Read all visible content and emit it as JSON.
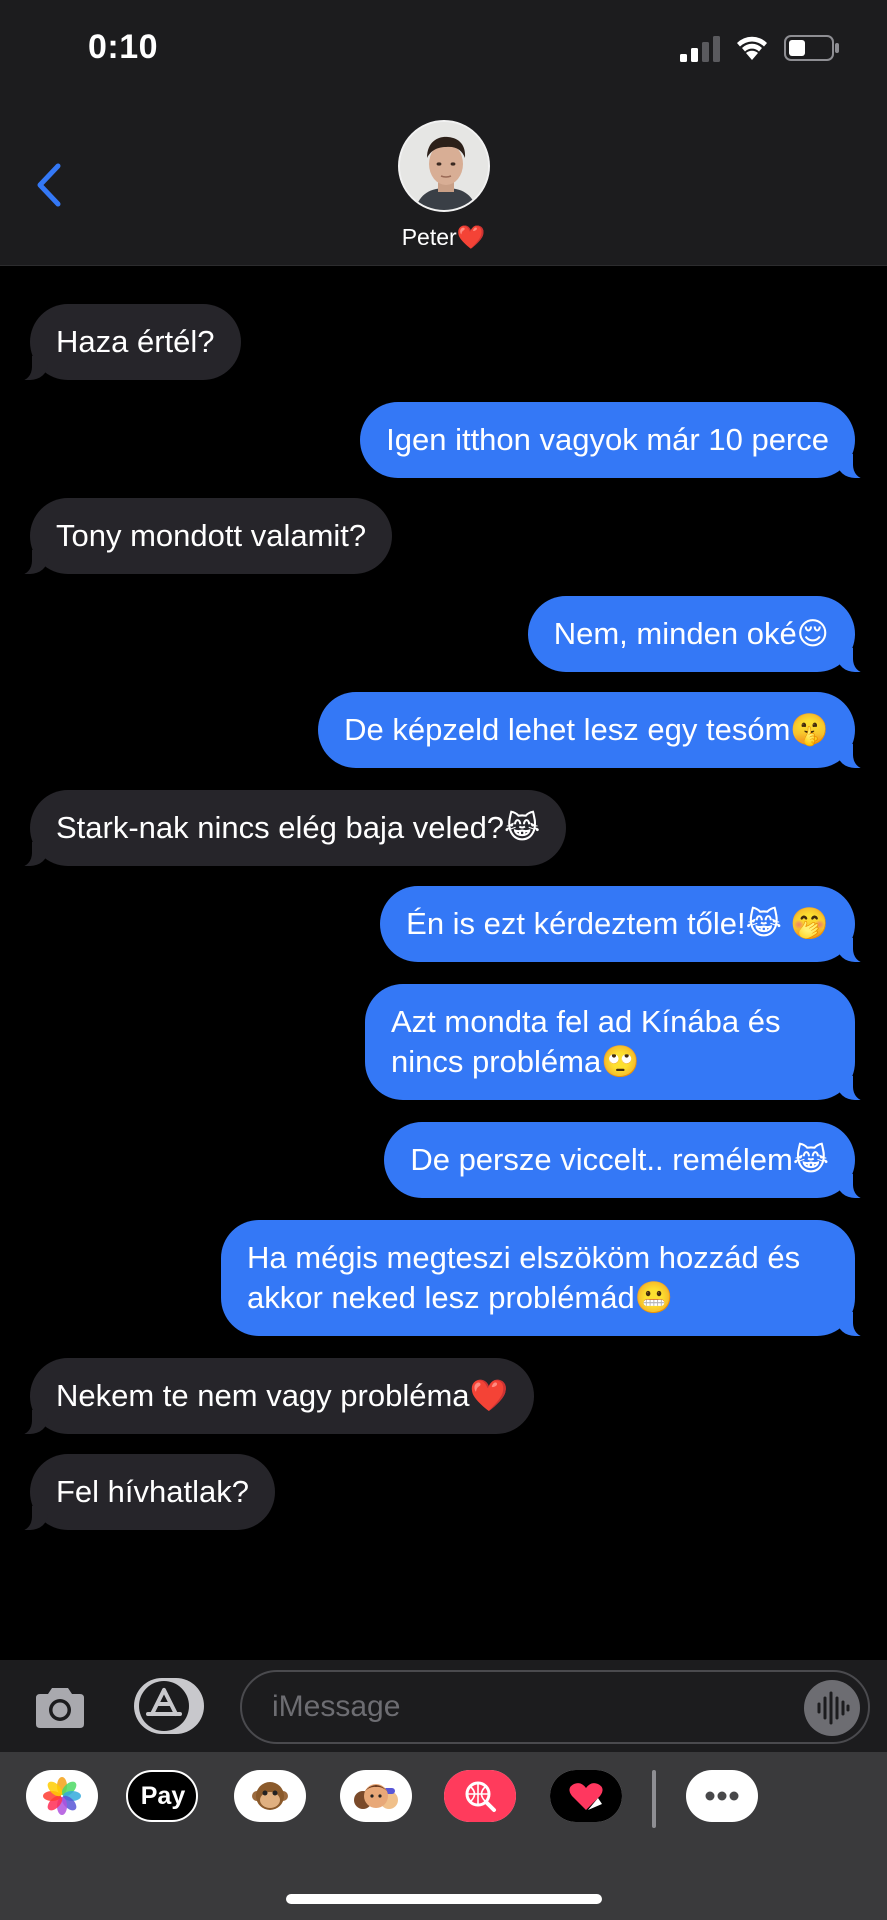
{
  "status_bar": {
    "time": "0:10"
  },
  "header": {
    "contact_name": "Peter❤️"
  },
  "messages": [
    {
      "dir": "in",
      "text": "Haza értél?"
    },
    {
      "dir": "out",
      "text": "Igen itthon vagyok már 10 perce"
    },
    {
      "dir": "in",
      "text": "Tony mondott valamit?"
    },
    {
      "dir": "out",
      "text": "Nem, minden oké😌"
    },
    {
      "dir": "out",
      "text": "De képzeld lehet lesz egy tesóm🤫"
    },
    {
      "dir": "in",
      "text": "Stark-nak nincs elég baja veled?😹"
    },
    {
      "dir": "out",
      "text": "Én is ezt kérdeztem tőle!😹 🤭"
    },
    {
      "dir": "out",
      "text": "Azt mondta fel ad Kínába és nincs probléma🙄"
    },
    {
      "dir": "out",
      "text": "De persze viccelt.. remélem😹"
    },
    {
      "dir": "out",
      "text": "Ha mégis megteszi elszököm hozzád és akkor neked lesz problémád😬"
    },
    {
      "dir": "in",
      "text": "Nekem te nem vagy probléma❤️"
    },
    {
      "dir": "in",
      "text": "Fel hívhatlak?"
    }
  ],
  "composer": {
    "placeholder": "iMessage"
  },
  "app_drawer": {
    "apple_pay_label": "Pay",
    "apps": [
      "photos-icon",
      "apple-pay-icon",
      "animoji-icon",
      "memoji-icon",
      "web-images-icon",
      "digital-touch-icon"
    ],
    "more_icon": "more-icon"
  },
  "colors": {
    "outgoing": "#3478f6",
    "incoming": "#26252a",
    "accent": "#3478f6"
  }
}
